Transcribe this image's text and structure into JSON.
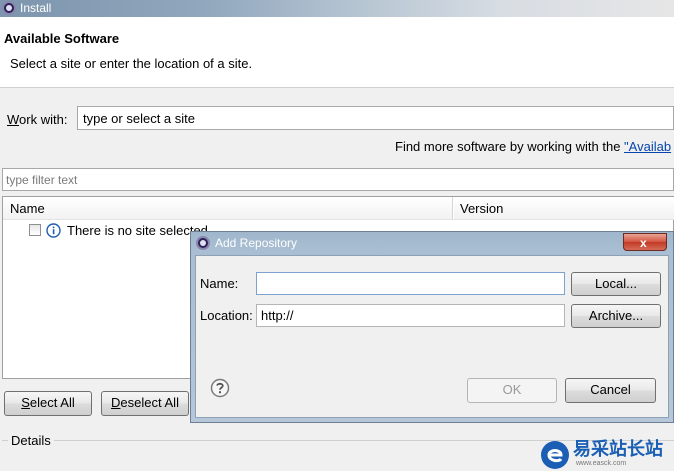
{
  "window": {
    "title": "Install"
  },
  "header": {
    "title": "Available Software",
    "description": "Select a site or enter the location of a site."
  },
  "work_with": {
    "label_first": "W",
    "label_rest": "ork with:",
    "value": "type or select a site"
  },
  "find_more": {
    "text": "Find more software by working with the ",
    "link": "\"Availab"
  },
  "filter": {
    "placeholder": "type filter text"
  },
  "table": {
    "columns": [
      "Name",
      "Version"
    ],
    "rows": [
      {
        "name": "There is no site selected."
      }
    ]
  },
  "buttons": {
    "select_all_first": "S",
    "select_all_rest": "elect All",
    "deselect_all_first": "D",
    "deselect_all_rest": "eselect All"
  },
  "details": {
    "label": "Details"
  },
  "dialog": {
    "title": "Add Repository",
    "close_label": "x",
    "name_label": "Name:",
    "name_value": "",
    "location_label": "Location:",
    "location_value": "http://",
    "local_button": "Local...",
    "archive_button": "Archive...",
    "ok_button": "OK",
    "cancel_button": "Cancel"
  },
  "watermark": {
    "text": "易采站长站",
    "subtext": "www.easck.com"
  },
  "colors": {
    "accent": "#0645ad",
    "dialog_title": "#a9bed2",
    "close": "#c13a25"
  },
  "icons": [
    "app-icon",
    "info-icon",
    "help-icon",
    "close-icon",
    "dialog-app-icon",
    "watermark-logo-icon"
  ]
}
